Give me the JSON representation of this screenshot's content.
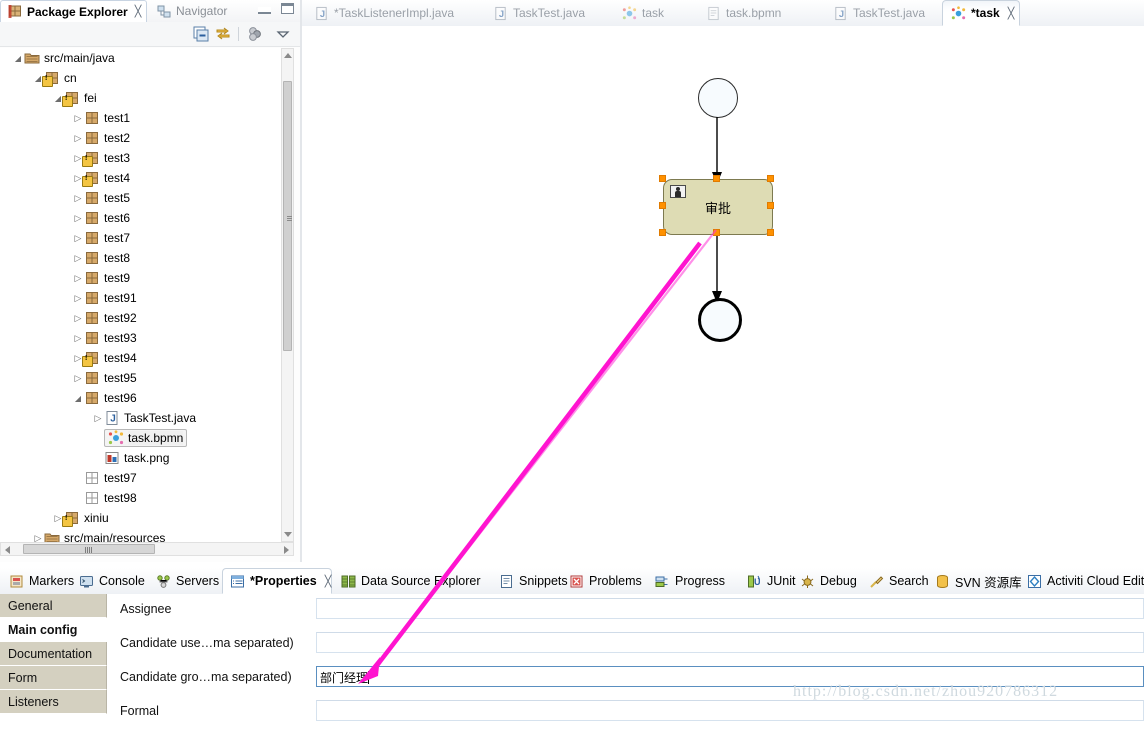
{
  "left_view": {
    "tabs": [
      {
        "label": "Package Explorer",
        "icon": "package-explorer-icon",
        "active": true,
        "closable": true
      },
      {
        "label": "Navigator",
        "icon": "navigator-icon",
        "active": false,
        "closable": false
      }
    ],
    "toolbar": [
      {
        "name": "collapse-all-icon"
      },
      {
        "name": "link-with-editor-icon"
      },
      {
        "name": "view-filters-icon"
      },
      {
        "name": "view-menu-icon"
      }
    ],
    "window_buttons": [
      {
        "name": "minimize-button"
      },
      {
        "name": "maximize-button"
      }
    ],
    "tree": [
      {
        "label": "src/main/java",
        "icon": "source-folder-icon",
        "indent": 0,
        "twisty": "open",
        "warn": false,
        "selected": false
      },
      {
        "label": "cn",
        "icon": "package-icon",
        "indent": 1,
        "twisty": "open",
        "warn": true,
        "selected": false
      },
      {
        "label": "fei",
        "icon": "package-icon",
        "indent": 2,
        "twisty": "open",
        "warn": true,
        "selected": false
      },
      {
        "label": "test1",
        "icon": "package-icon",
        "indent": 3,
        "twisty": "closed",
        "warn": false,
        "selected": false
      },
      {
        "label": "test2",
        "icon": "package-icon",
        "indent": 3,
        "twisty": "closed",
        "warn": false,
        "selected": false
      },
      {
        "label": "test3",
        "icon": "package-icon",
        "indent": 3,
        "twisty": "closed",
        "warn": true,
        "selected": false
      },
      {
        "label": "test4",
        "icon": "package-icon",
        "indent": 3,
        "twisty": "closed",
        "warn": true,
        "selected": false
      },
      {
        "label": "test5",
        "icon": "package-icon",
        "indent": 3,
        "twisty": "closed",
        "warn": false,
        "selected": false
      },
      {
        "label": "test6",
        "icon": "package-icon",
        "indent": 3,
        "twisty": "closed",
        "warn": false,
        "selected": false
      },
      {
        "label": "test7",
        "icon": "package-icon",
        "indent": 3,
        "twisty": "closed",
        "warn": false,
        "selected": false
      },
      {
        "label": "test8",
        "icon": "package-icon",
        "indent": 3,
        "twisty": "closed",
        "warn": false,
        "selected": false
      },
      {
        "label": "test9",
        "icon": "package-icon",
        "indent": 3,
        "twisty": "closed",
        "warn": false,
        "selected": false
      },
      {
        "label": "test91",
        "icon": "package-icon",
        "indent": 3,
        "twisty": "closed",
        "warn": false,
        "selected": false
      },
      {
        "label": "test92",
        "icon": "package-icon",
        "indent": 3,
        "twisty": "closed",
        "warn": false,
        "selected": false
      },
      {
        "label": "test93",
        "icon": "package-icon",
        "indent": 3,
        "twisty": "closed",
        "warn": false,
        "selected": false
      },
      {
        "label": "test94",
        "icon": "package-icon",
        "indent": 3,
        "twisty": "closed",
        "warn": true,
        "selected": false
      },
      {
        "label": "test95",
        "icon": "package-icon",
        "indent": 3,
        "twisty": "closed",
        "warn": false,
        "selected": false
      },
      {
        "label": "test96",
        "icon": "package-icon",
        "indent": 3,
        "twisty": "open",
        "warn": false,
        "selected": false
      },
      {
        "label": "TaskTest.java",
        "icon": "java-file-icon",
        "indent": 4,
        "twisty": "closed",
        "warn": false,
        "selected": false
      },
      {
        "label": "task.bpmn",
        "icon": "bpmn-file-icon",
        "indent": 4,
        "twisty": "none",
        "warn": false,
        "selected": true
      },
      {
        "label": "task.png",
        "icon": "png-file-icon",
        "indent": 4,
        "twisty": "none",
        "warn": false,
        "selected": false
      },
      {
        "label": "test97",
        "icon": "package-empty-icon",
        "indent": 3,
        "twisty": "none",
        "warn": false,
        "selected": false
      },
      {
        "label": "test98",
        "icon": "package-empty-icon",
        "indent": 3,
        "twisty": "none",
        "warn": false,
        "selected": false
      },
      {
        "label": "xiniu",
        "icon": "package-icon",
        "indent": 2,
        "twisty": "closed",
        "warn": true,
        "selected": false
      },
      {
        "label": "src/main/resources",
        "icon": "source-folder-icon",
        "indent": 1,
        "twisty": "closed",
        "warn": false,
        "selected": false
      }
    ]
  },
  "editor": {
    "tabs": [
      {
        "label": "*TaskListenerImpl.java",
        "icon": "java-file-icon",
        "active": false,
        "closable": false
      },
      {
        "label": "TaskTest.java",
        "icon": "java-file-icon",
        "active": false,
        "closable": false
      },
      {
        "label": "task",
        "icon": "bpmn-file-icon",
        "active": false,
        "closable": false
      },
      {
        "label": "task.bpmn",
        "icon": "xml-file-icon",
        "active": false,
        "closable": false
      },
      {
        "label": "TaskTest.java",
        "icon": "java-file-icon",
        "active": false,
        "closable": false
      },
      {
        "label": "*task",
        "icon": "bpmn-file-icon",
        "active": true,
        "closable": true
      }
    ],
    "diagram": {
      "start_event": {
        "name": "start-event",
        "label": ""
      },
      "user_task": {
        "name": "user-task",
        "label": "审批",
        "icon": "user-task-icon",
        "selected": true,
        "fill_color": "#dedcb4",
        "border_color": "#7d7a50",
        "handle_color": "#ff9100"
      },
      "end_event": {
        "name": "end-event",
        "label": ""
      },
      "flows": [
        {
          "from": "start-event",
          "to": "user-task"
        },
        {
          "from": "user-task",
          "to": "end-event"
        }
      ]
    }
  },
  "bottom_views": {
    "tabs": [
      {
        "label": "Markers",
        "icon": "markers-icon",
        "active": false
      },
      {
        "label": "Console",
        "icon": "console-icon",
        "active": false
      },
      {
        "label": "Servers",
        "icon": "servers-icon",
        "active": false
      },
      {
        "label": "*Properties",
        "icon": "properties-icon",
        "active": true,
        "closable": true
      },
      {
        "label": "Data Source Explorer",
        "icon": "datasource-icon",
        "active": false
      },
      {
        "label": "Snippets",
        "icon": "snippets-icon",
        "active": false
      },
      {
        "label": "Problems",
        "icon": "problems-icon",
        "active": false
      },
      {
        "label": "Progress",
        "icon": "progress-icon",
        "active": false
      },
      {
        "label": "JUnit",
        "icon": "junit-icon",
        "active": false
      },
      {
        "label": "Debug",
        "icon": "debug-icon",
        "active": false
      },
      {
        "label": "Search",
        "icon": "search-icon",
        "active": false
      },
      {
        "label": "SVN 资源库",
        "icon": "svn-repository-icon",
        "active": false
      },
      {
        "label": "Activiti Cloud Edit",
        "icon": "activiti-cloud-icon",
        "active": false
      }
    ]
  },
  "properties": {
    "tabs": [
      {
        "label": "General",
        "selected": false
      },
      {
        "label": "Main config",
        "selected": true
      },
      {
        "label": "Documentation",
        "selected": false
      },
      {
        "label": "Form",
        "selected": false
      },
      {
        "label": "Listeners",
        "selected": false
      }
    ],
    "fields": [
      {
        "label": "Assignee",
        "value": "",
        "placeholder": "",
        "focused": false
      },
      {
        "label": "Candidate use…ma separated)",
        "value": "",
        "placeholder": "",
        "focused": false
      },
      {
        "label": "Candidate gro…ma separated)",
        "value": "部门经理",
        "placeholder": "",
        "focused": true
      },
      {
        "label": "Formal",
        "value": "",
        "placeholder": "",
        "focused": false
      }
    ]
  },
  "annotation": {
    "arrow_color": "#ff00d0",
    "watermark": "http://blog.csdn.net/zhou920786312"
  }
}
